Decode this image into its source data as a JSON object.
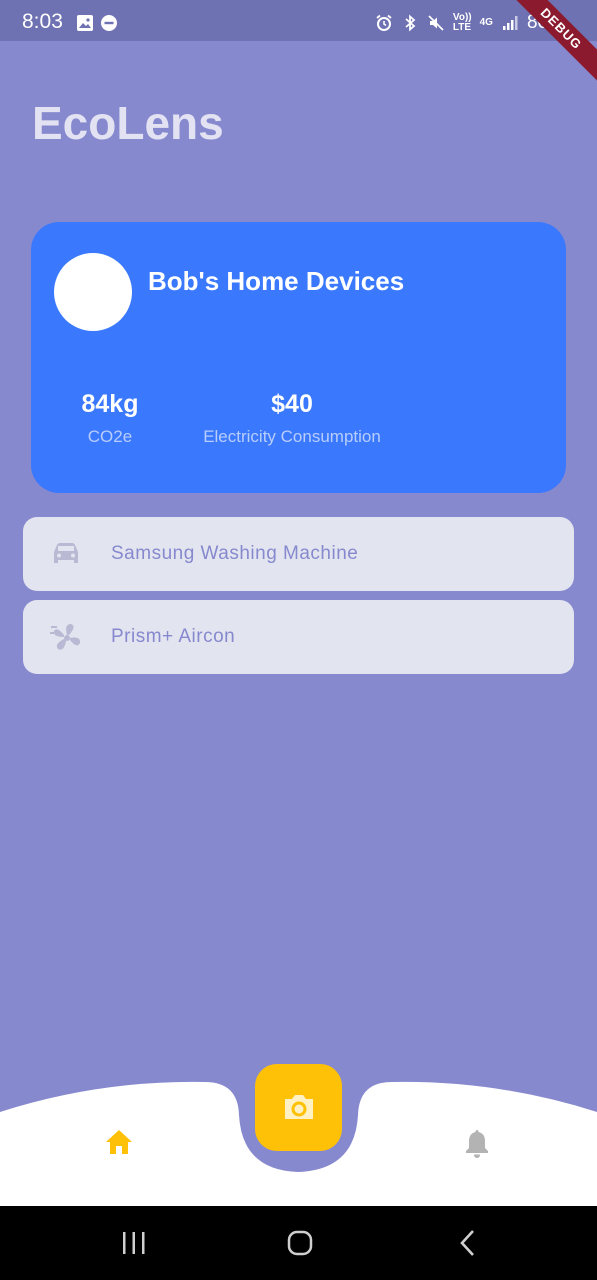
{
  "status_bar": {
    "time": "8:03",
    "network_top": "Vo))",
    "network_bottom": "LTE",
    "signal_gen": "4G",
    "battery": "80%",
    "debug_label": "DEBUG"
  },
  "app": {
    "title": "EcoLens"
  },
  "summary_card": {
    "title": "Bob's Home Devices",
    "co2_value": "84kg",
    "co2_label": "CO2e",
    "cost_value": "$40",
    "cost_label": "Electricity Consumption"
  },
  "devices": [
    {
      "label": "Samsung Washing Machine",
      "icon": "car-icon"
    },
    {
      "label": "Prism+ Aircon",
      "icon": "fan-icon"
    }
  ],
  "bottom_nav": {
    "home_icon": "home-icon",
    "camera_icon": "camera-icon",
    "notifications_icon": "bell-icon"
  },
  "colors": {
    "background": "#8789cf",
    "card": "#3a78fd",
    "accent": "#ffc107",
    "list_item": "#e2e4ef"
  }
}
